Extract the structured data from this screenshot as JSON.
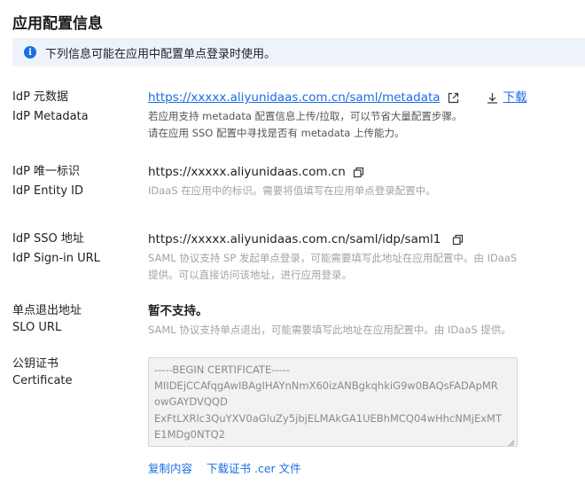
{
  "page_title": "应用配置信息",
  "alert": {
    "text": "下列信息可能在应用中配置单点登录时使用。",
    "icon": "info-icon"
  },
  "metadata": {
    "label_zh": "IdP 元数据",
    "label_en": "IdP Metadata",
    "url": "https://xxxxx.aliyunidaas.com.cn/saml/metadata",
    "download_label": "下载",
    "desc_line1": "若应用支持 metadata 配置信息上传/拉取，可以节省大量配置步骤。",
    "desc_line2": "请在应用 SSO 配置中寻找是否有 metadata 上传能力。"
  },
  "entity_id": {
    "label_zh": "IdP 唯一标识",
    "label_en": "IdP Entity ID",
    "value": "https://xxxxx.aliyunidaas.com.cn",
    "hint": "IDaaS 在应用中的标识。需要将值填写在应用单点登录配置中。"
  },
  "sso_url": {
    "label_zh": "IdP SSO 地址",
    "label_en": "IdP Sign-in URL",
    "value": "https://xxxxx.aliyunidaas.com.cn/saml/idp/saml1",
    "hint_line1": "SAML 协议支持 SP 发起单点登录，可能需要填写此地址在应用配置中。由 IDaaS",
    "hint_line2": "提供。可以直接访问该地址，进行应用登录。"
  },
  "slo": {
    "label_zh": "单点退出地址",
    "label_en": "SLO URL",
    "value": "暂不支持。",
    "hint": "SAML 协议支持单点退出，可能需要填写此地址在应用配置中。由 IDaaS 提供。"
  },
  "certificate": {
    "label_zh": "公钥证书",
    "label_en": "Certificate",
    "lines": [
      "-----BEGIN CERTIFICATE-----",
      "MIIDEjCCAfqgAwIBAgIHAYnNmX60izANBgkqhkiG9w0BAQsFADApMR",
      "owGAYDVQQD",
      "ExFtLXRlc3QuYXV0aGluZy5jbjELMAkGA1UEBhMCQ04wHhcNMjExMT",
      "E1MDg0NTQ2"
    ],
    "copy_label": "复制内容",
    "download_label": "下载证书 .cer 文件"
  },
  "colors": {
    "link": "#1a6ee6",
    "alert_bg": "#eef3fb",
    "hint": "#a3a3a3"
  }
}
